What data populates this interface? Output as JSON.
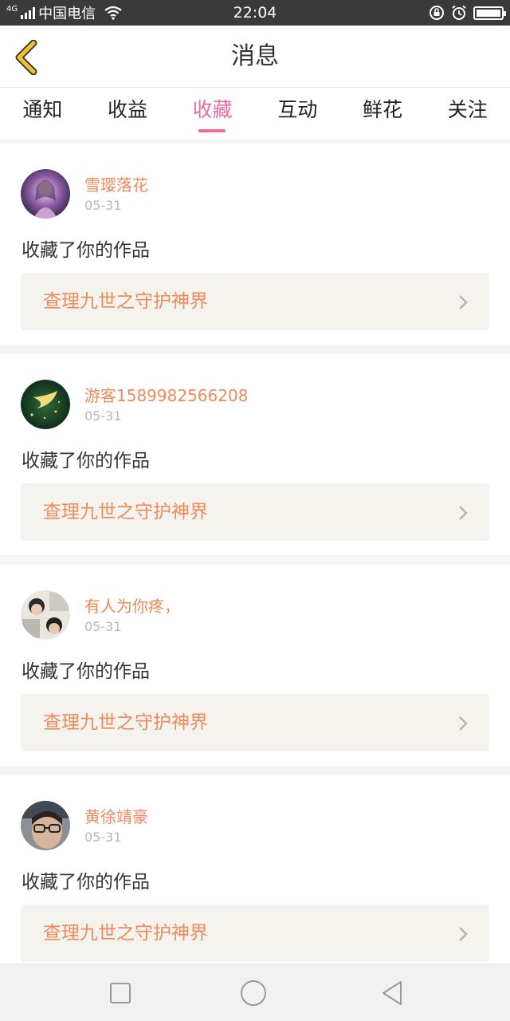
{
  "status_bar": {
    "network": "4G",
    "carrier": "中国电信",
    "time": "22:04"
  },
  "header": {
    "title": "消息",
    "back_icon": "chevron-left-icon",
    "accent_color": "#f2c12e"
  },
  "tabs": [
    {
      "label": "通知",
      "active": false
    },
    {
      "label": "收益",
      "active": false
    },
    {
      "label": "收藏",
      "active": true
    },
    {
      "label": "互动",
      "active": false
    },
    {
      "label": "鲜花",
      "active": false
    },
    {
      "label": "关注",
      "active": false
    }
  ],
  "colors": {
    "active_tab": "#ec6aa0",
    "username": "#ef8a5b",
    "link_bg": "#f4f3ed"
  },
  "messages": [
    {
      "username": "雪璎落花",
      "date": "05-31",
      "action": "收藏了你的作品",
      "work_title": "查理九世之守护神界"
    },
    {
      "username": "游客1589982566208",
      "date": "05-31",
      "action": "收藏了你的作品",
      "work_title": "查理九世之守护神界"
    },
    {
      "username": "有人为你疼，",
      "date": "05-31",
      "action": "收藏了你的作品",
      "work_title": "查理九世之守护神界"
    },
    {
      "username": "黄徐靖豪",
      "date": "05-31",
      "action": "收藏了你的作品",
      "work_title": "查理九世之守护神界"
    }
  ],
  "nav_bar": {
    "icons": [
      "square-recents-icon",
      "circle-home-icon",
      "triangle-back-icon"
    ]
  }
}
